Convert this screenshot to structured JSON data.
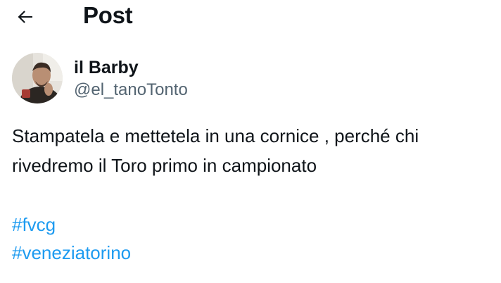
{
  "header": {
    "back_icon": "arrow-left-icon",
    "title": "Post"
  },
  "author": {
    "display_name": "il Barby",
    "handle": "@el_tanoTonto"
  },
  "tweet": {
    "lines": [
      "Stampatela e mettetela in una cornice , perché chi",
      "rivedremo il Toro primo in campionato"
    ],
    "hashtags": [
      "#fvcg",
      "#veneziatorino"
    ]
  },
  "colors": {
    "text": "#0f1419",
    "secondary_text": "#536471",
    "link": "#1d9bf0",
    "background": "#ffffff"
  }
}
